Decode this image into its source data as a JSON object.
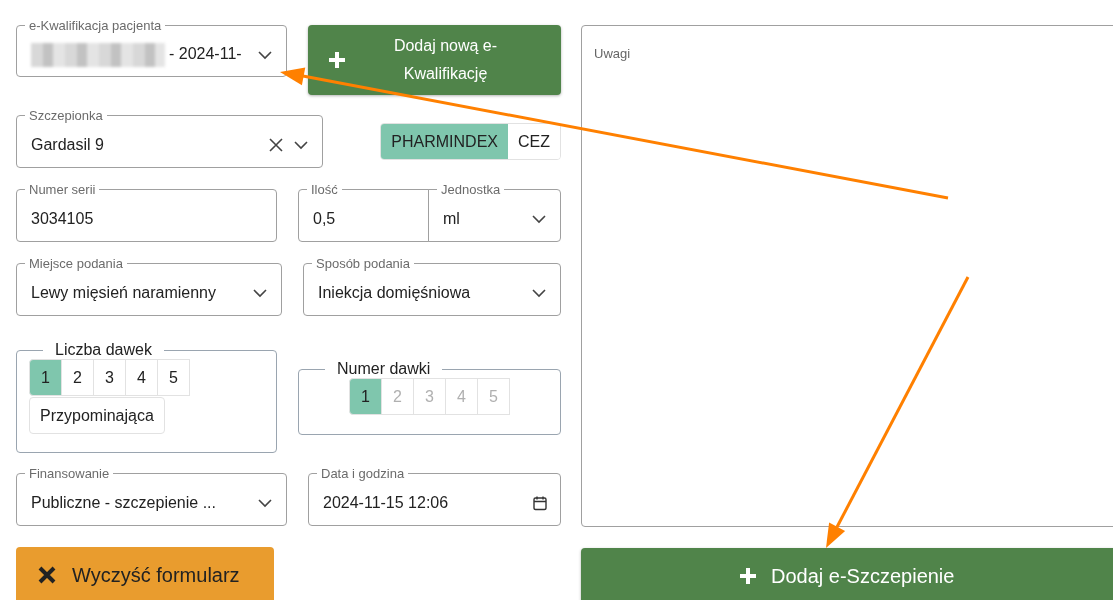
{
  "qualification": {
    "label": "e-Kwalifikacja pacjenta",
    "value": "- 2024-11-",
    "redacted": true
  },
  "add_qualification_button": {
    "label": "Dodaj nową e-Kwalifikację"
  },
  "vaccine": {
    "label": "Szczepionka",
    "value": "Gardasil 9",
    "clearable": true
  },
  "sources": [
    {
      "label": "PHARMINDEX",
      "selected": true
    },
    {
      "label": "CEZ",
      "selected": false
    }
  ],
  "series": {
    "label": "Numer serii",
    "value": "3034105"
  },
  "amount": {
    "label": "Ilość",
    "value": "0,5"
  },
  "unit": {
    "label": "Jednostka",
    "value": "ml"
  },
  "site": {
    "label": "Miejsce podania",
    "value": "Lewy mięsień naramienny"
  },
  "route": {
    "label": "Sposób podania",
    "value": "Iniekcja domięśniowa"
  },
  "dose_count": {
    "label": "Liczba dawek",
    "options": [
      {
        "label": "1",
        "selected": true,
        "disabled": false
      },
      {
        "label": "2",
        "selected": false,
        "disabled": false
      },
      {
        "label": "3",
        "selected": false,
        "disabled": false
      },
      {
        "label": "4",
        "selected": false,
        "disabled": false
      },
      {
        "label": "5",
        "selected": false,
        "disabled": false
      }
    ],
    "booster": {
      "label": "Przypominająca",
      "selected": false
    }
  },
  "dose_number": {
    "label": "Numer dawki",
    "options": [
      {
        "label": "1",
        "selected": true,
        "disabled": false
      },
      {
        "label": "2",
        "selected": false,
        "disabled": true
      },
      {
        "label": "3",
        "selected": false,
        "disabled": true
      },
      {
        "label": "4",
        "selected": false,
        "disabled": true
      },
      {
        "label": "5",
        "selected": false,
        "disabled": true
      }
    ]
  },
  "financing": {
    "label": "Finansowanie",
    "value": "Publiczne - szczepienie ..."
  },
  "datetime": {
    "label": "Data i godzina",
    "value": "2024-11-15 12:06"
  },
  "clear_button": {
    "label": "Wyczyść formularz"
  },
  "notes": {
    "placeholder": "Uwagi"
  },
  "submit_button": {
    "label": "Dodaj e-Szczepienie"
  },
  "annotations": [
    {
      "kind": "arrow"
    },
    {
      "kind": "arrow"
    }
  ]
}
